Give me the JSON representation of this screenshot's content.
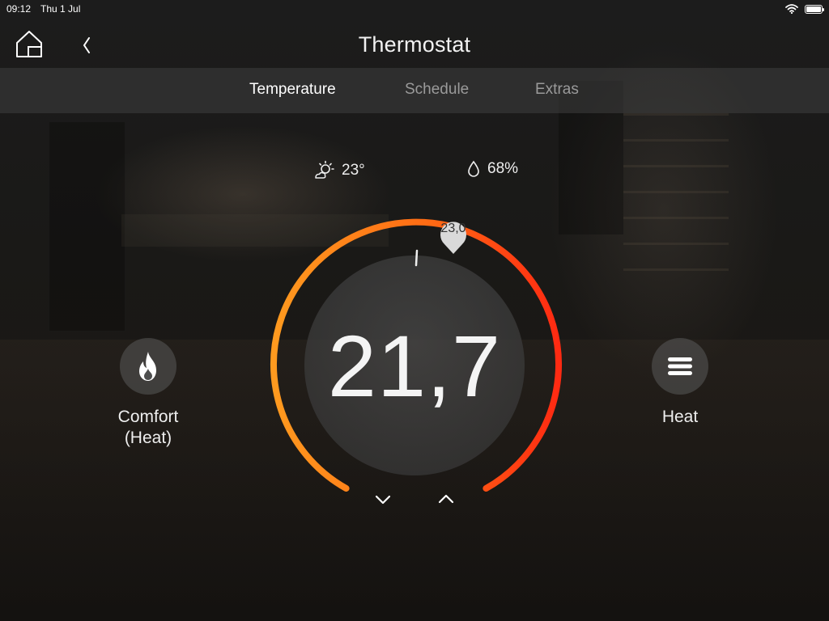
{
  "status_bar": {
    "time": "09:12",
    "date": "Thu 1 Jul",
    "icons": [
      "wifi-icon",
      "battery-icon"
    ]
  },
  "header": {
    "title": "Thermostat",
    "icons": [
      "home-icon",
      "back-chevron-icon"
    ]
  },
  "tabs": [
    {
      "label": "Temperature",
      "active": true
    },
    {
      "label": "Schedule",
      "active": false
    },
    {
      "label": "Extras",
      "active": false
    }
  ],
  "weather": {
    "outdoor_temp": "23°",
    "outdoor_icon": "sun-cloud-icon",
    "humidity": "68%",
    "humidity_icon": "droplet-icon"
  },
  "thermostat": {
    "current_temp": "21,7",
    "setpoint": "23,0",
    "arc_colors": {
      "start": "#ff9a1f",
      "middle": "#ff6a14",
      "end": "#ff2a12"
    }
  },
  "controls": {
    "decrease_icon": "chevron-down-icon",
    "increase_icon": "chevron-up-icon"
  },
  "mode": {
    "label_line1": "Comfort",
    "label_line2": "(Heat)",
    "icon": "flame-icon"
  },
  "hvac": {
    "label": "Heat",
    "icon": "menu-lines-icon"
  }
}
